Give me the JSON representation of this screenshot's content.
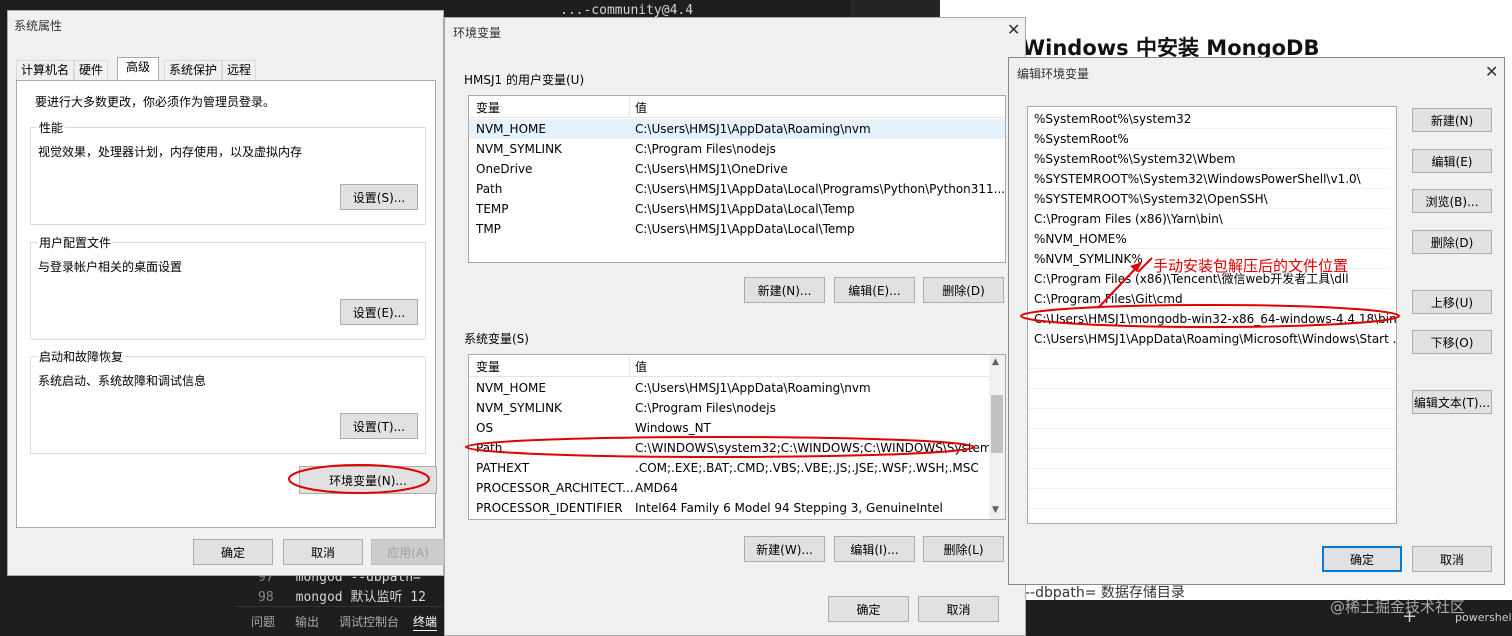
{
  "background": {
    "code_lines": [
      {
        "num": "97",
        "text": "mongod --dbpath="
      },
      {
        "num": "98",
        "text": "mongod 默认监听 12"
      }
    ],
    "top_code": "...-community@4.4",
    "panel_tabs": [
      "问题",
      "输出",
      "调试控制台",
      "终端"
    ],
    "web_title": "Windows 中安装 MongoDB",
    "web_text": "--dbpath= 数据存储目录",
    "web_watermark": "@稀土掘金技术社区",
    "terminal_label": "powershell",
    "plus_label": "+"
  },
  "sys_props": {
    "title": "系统属性",
    "tabs": [
      "计算机名",
      "硬件",
      "高级",
      "系统保护",
      "远程"
    ],
    "active_tab": 2,
    "admin_note": "要进行大多数更改，你必须作为管理员登录。",
    "groups": [
      {
        "label": "性能",
        "desc": "视觉效果，处理器计划，内存使用，以及虚拟内存",
        "button": "设置(S)..."
      },
      {
        "label": "用户配置文件",
        "desc": "与登录帐户相关的桌面设置",
        "button": "设置(E)..."
      },
      {
        "label": "启动和故障恢复",
        "desc": "系统启动、系统故障和调试信息",
        "button": "设置(T)..."
      }
    ],
    "env_button": "环境变量(N)...",
    "ok": "确定",
    "cancel": "取消",
    "apply": "应用(A)"
  },
  "env_vars": {
    "title": "环境变量",
    "user_group": "HMSJ1 的用户变量(U)",
    "system_group": "系统变量(S)",
    "col_var": "变量",
    "col_val": "值",
    "user_rows": [
      {
        "name": "NVM_HOME",
        "value": "C:\\Users\\HMSJ1\\AppData\\Roaming\\nvm"
      },
      {
        "name": "NVM_SYMLINK",
        "value": "C:\\Program Files\\nodejs"
      },
      {
        "name": "OneDrive",
        "value": "C:\\Users\\HMSJ1\\OneDrive"
      },
      {
        "name": "Path",
        "value": "C:\\Users\\HMSJ1\\AppData\\Local\\Programs\\Python\\Python311..."
      },
      {
        "name": "TEMP",
        "value": "C:\\Users\\HMSJ1\\AppData\\Local\\Temp"
      },
      {
        "name": "TMP",
        "value": "C:\\Users\\HMSJ1\\AppData\\Local\\Temp"
      }
    ],
    "system_rows": [
      {
        "name": "NVM_HOME",
        "value": "C:\\Users\\HMSJ1\\AppData\\Roaming\\nvm"
      },
      {
        "name": "NVM_SYMLINK",
        "value": "C:\\Program Files\\nodejs"
      },
      {
        "name": "OS",
        "value": "Windows_NT"
      },
      {
        "name": "Path",
        "value": "C:\\WINDOWS\\system32;C:\\WINDOWS;C:\\WINDOWS\\System..."
      },
      {
        "name": "PATHEXT",
        "value": ".COM;.EXE;.BAT;.CMD;.VBS;.VBE;.JS;.JSE;.WSF;.WSH;.MSC"
      },
      {
        "name": "PROCESSOR_ARCHITECT...",
        "value": "AMD64"
      },
      {
        "name": "PROCESSOR_IDENTIFIER",
        "value": "Intel64 Family 6 Model 94 Stepping 3, GenuineIntel"
      }
    ],
    "user_buttons": [
      "新建(N)...",
      "编辑(E)...",
      "删除(D)"
    ],
    "system_buttons": [
      "新建(W)...",
      "编辑(I)...",
      "删除(L)"
    ],
    "ok": "确定",
    "cancel": "取消"
  },
  "edit_env": {
    "title": "编辑环境变量",
    "entries": [
      "%SystemRoot%\\system32",
      "%SystemRoot%",
      "%SystemRoot%\\System32\\Wbem",
      "%SYSTEMROOT%\\System32\\WindowsPowerShell\\v1.0\\",
      "%SYSTEMROOT%\\System32\\OpenSSH\\",
      "C:\\Program Files (x86)\\Yarn\\bin\\",
      "%NVM_HOME%",
      "%NVM_SYMLINK%",
      "C:\\Program Files (x86)\\Tencent\\微信web开发者工具\\dll",
      "C:\\Program Files\\Git\\cmd",
      "C:\\Users\\HMSJ1\\mongodb-win32-x86_64-windows-4.4.18\\bin",
      "C:\\Users\\HMSJ1\\AppData\\Roaming\\Microsoft\\Windows\\Start ..."
    ],
    "buttons": [
      "新建(N)",
      "编辑(E)",
      "浏览(B)...",
      "删除(D)",
      "上移(U)",
      "下移(O)",
      "编辑文本(T)..."
    ],
    "ok": "确定",
    "cancel": "取消",
    "annotation": "手动安装包解压后的文件位置",
    "annotation_color": "#e00000"
  }
}
